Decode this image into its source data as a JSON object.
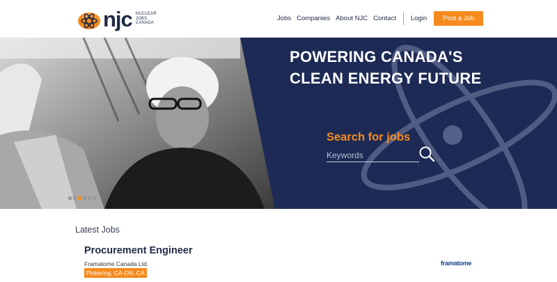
{
  "brand": {
    "word": "njc",
    "tagline": [
      "NUCLEAR",
      "JOBS",
      "CANADA"
    ]
  },
  "nav": {
    "jobs": "Jobs",
    "companies": "Companies",
    "about": "About NJC",
    "contact": "Contact",
    "login": "Login",
    "post_job": "Post a Job"
  },
  "hero": {
    "title_line1": "POWERING CANADA'S",
    "title_line2": "CLEAN ENERGY FUTURE",
    "search_label": "Search for jobs",
    "search_placeholder": "Keywords",
    "slides": 6,
    "active_slide": 3
  },
  "latest": {
    "heading": "Latest Jobs",
    "jobs": [
      {
        "title": "Procurement Engineer",
        "company": "Framatome Canada Ltd.",
        "location": "Pickering, CA-ON, CA",
        "company_logo": "framatome"
      }
    ]
  },
  "colors": {
    "accent": "#f58b1f",
    "navy": "#1d2a55"
  }
}
